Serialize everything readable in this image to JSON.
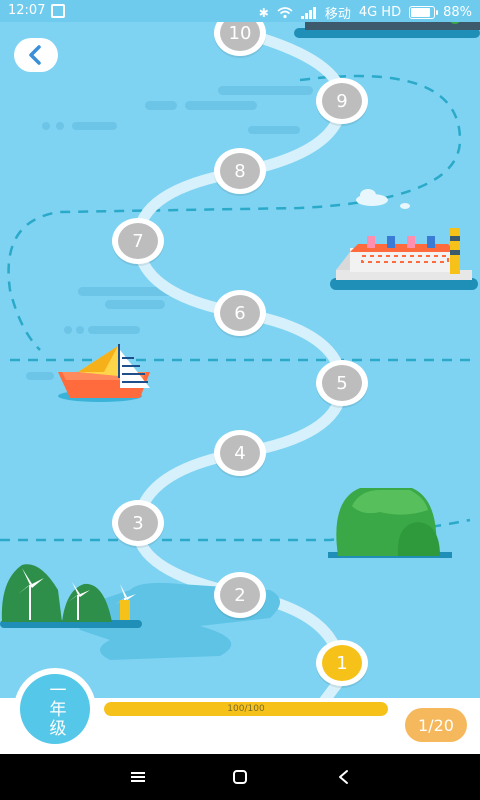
{
  "status_bar": {
    "time": "12:07",
    "carrier": "移动",
    "network": "4G HD",
    "battery": "88%",
    "battery_level": 0.88
  },
  "levels": [
    {
      "label": "1",
      "state": "active"
    },
    {
      "label": "2",
      "state": "locked"
    },
    {
      "label": "3",
      "state": "locked"
    },
    {
      "label": "4",
      "state": "locked"
    },
    {
      "label": "5",
      "state": "locked"
    },
    {
      "label": "6",
      "state": "locked"
    },
    {
      "label": "7",
      "state": "locked"
    },
    {
      "label": "8",
      "state": "locked"
    },
    {
      "label": "9",
      "state": "locked"
    },
    {
      "label": "10",
      "state": "locked"
    }
  ],
  "grade": {
    "label": "一年级"
  },
  "progress": {
    "text": "100/100",
    "fraction": 1.0
  },
  "counter": {
    "text": "1/20"
  },
  "colors": {
    "sky": "#7fd3f2",
    "path": "#cfefff",
    "locked": "#bdbdbd",
    "active": "#f6c21a",
    "grade_badge": "#55c7e8",
    "counter_pill": "#f6b85c"
  },
  "icons": {
    "back": "chevron-left-icon",
    "nav_menu": "menu-icon",
    "nav_home": "home-square-icon",
    "nav_back": "back-triangle-icon"
  }
}
